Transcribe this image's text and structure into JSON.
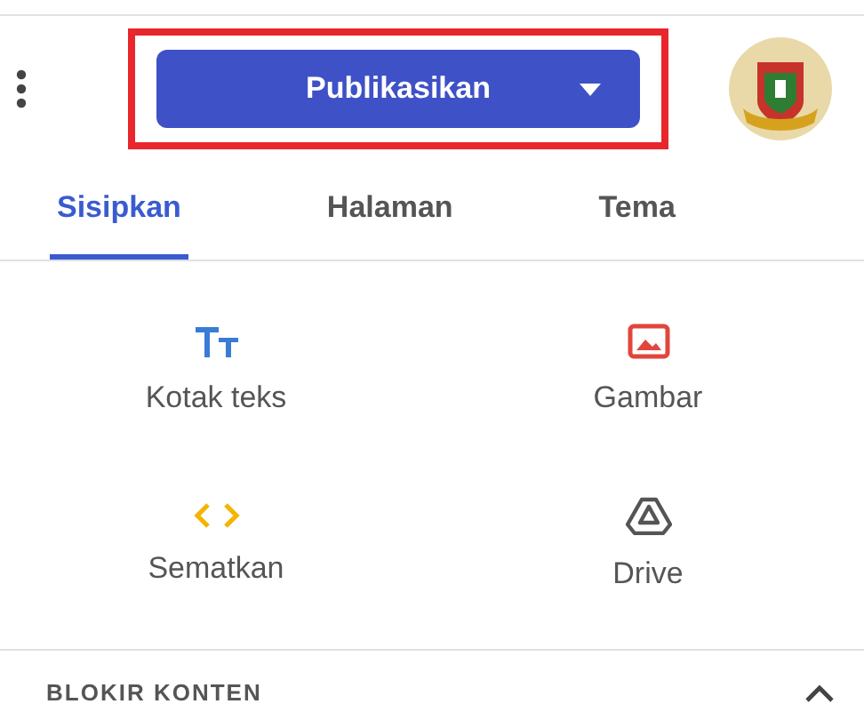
{
  "toolbar": {
    "publish_button": {
      "label": "Publikasikan",
      "highlighted": true
    }
  },
  "tabs": [
    {
      "label": "Sisipkan",
      "selected": true
    },
    {
      "label": "Halaman",
      "selected": false
    },
    {
      "label": "Tema",
      "selected": false
    }
  ],
  "insert_items": [
    {
      "kind": "textbox",
      "label": "Kotak teks"
    },
    {
      "kind": "image",
      "label": "Gambar"
    },
    {
      "kind": "embed",
      "label": "Sematkan"
    },
    {
      "kind": "drive",
      "label": "Drive"
    }
  ],
  "section": {
    "title": "BLOKIR KONTEN",
    "expanded": true
  }
}
